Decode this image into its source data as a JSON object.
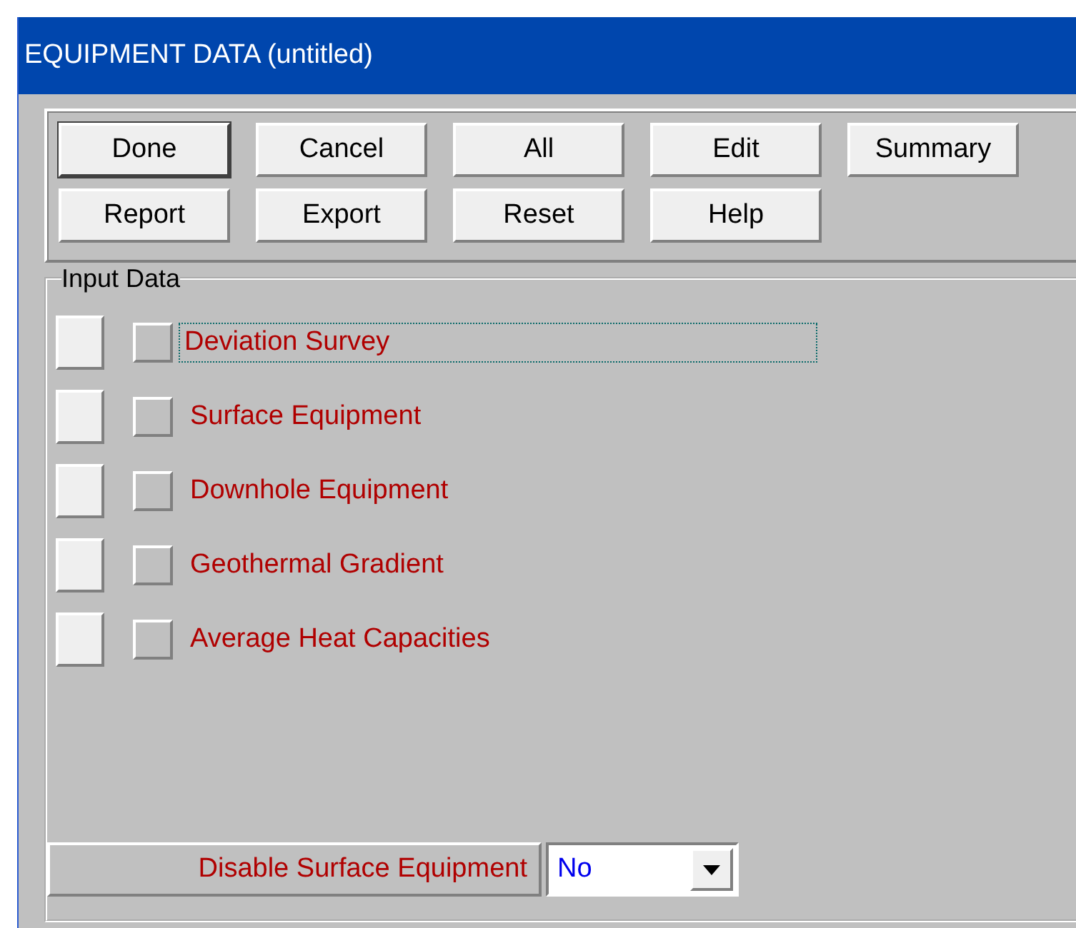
{
  "window": {
    "title": "EQUIPMENT DATA (untitled)"
  },
  "buttons": [
    {
      "label": "Done",
      "default": true
    },
    {
      "label": "Cancel",
      "default": false
    },
    {
      "label": "All",
      "default": false
    },
    {
      "label": "Edit",
      "default": false
    },
    {
      "label": "Summary",
      "default": false
    },
    {
      "label": "Report",
      "default": false
    },
    {
      "label": "Export",
      "default": false
    },
    {
      "label": "Reset",
      "default": false
    },
    {
      "label": "Help",
      "default": false
    }
  ],
  "input_data": {
    "title": "Input Data",
    "items": [
      {
        "label": "Deviation Survey",
        "focused": true,
        "checked": false
      },
      {
        "label": "Surface Equipment",
        "focused": false,
        "checked": false
      },
      {
        "label": "Downhole Equipment",
        "focused": false,
        "checked": false
      },
      {
        "label": "Geothermal Gradient",
        "focused": false,
        "checked": false
      },
      {
        "label": "Average Heat Capacities",
        "focused": false,
        "checked": false
      }
    ]
  },
  "disable_surface_equipment": {
    "label": "Disable Surface Equipment",
    "value": "No"
  }
}
